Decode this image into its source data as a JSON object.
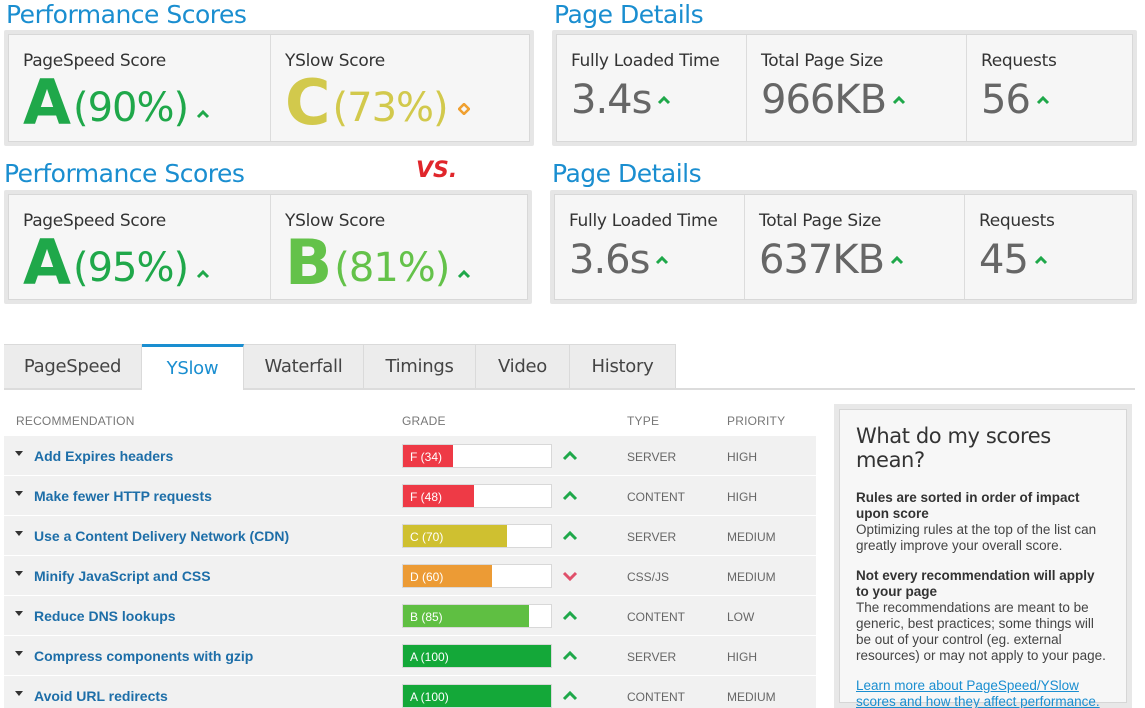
{
  "top_comparison": {
    "performance_title": "Performance Scores",
    "page_details_title": "Page Details",
    "pagespeed_label": "PageSpeed Score",
    "yslow_label": "YSlow Score",
    "fully_loaded_label": "Fully Loaded Time",
    "page_size_label": "Total Page Size",
    "requests_label": "Requests",
    "pagespeed_grade": "A",
    "pagespeed_pct": "(90%)",
    "yslow_grade": "C",
    "yslow_pct": "(73%)",
    "fully_loaded": "3.4s",
    "page_size": "966KB",
    "requests": "56"
  },
  "vs_label": "VS.",
  "bottom_comparison": {
    "performance_title": "Performance Scores",
    "page_details_title": "Page Details",
    "pagespeed_label": "PageSpeed Score",
    "yslow_label": "YSlow Score",
    "fully_loaded_label": "Fully Loaded Time",
    "page_size_label": "Total Page Size",
    "requests_label": "Requests",
    "pagespeed_grade": "A",
    "pagespeed_pct": "(95%)",
    "yslow_grade": "B",
    "yslow_pct": "(81%)",
    "fully_loaded": "3.6s",
    "page_size": "637KB",
    "requests": "45"
  },
  "tabs": [
    {
      "label": "PageSpeed",
      "active": false
    },
    {
      "label": "YSlow",
      "active": true
    },
    {
      "label": "Waterfall",
      "active": false
    },
    {
      "label": "Timings",
      "active": false
    },
    {
      "label": "Video",
      "active": false
    },
    {
      "label": "History",
      "active": false
    }
  ],
  "table": {
    "headers": {
      "recommendation": "RECOMMENDATION",
      "grade": "GRADE",
      "type": "TYPE",
      "priority": "PRIORITY"
    },
    "rows": [
      {
        "recommendation": "Add Expires headers",
        "grade": "F (34)",
        "score": 34,
        "color": "#ee3a46",
        "trend": "up",
        "type": "SERVER",
        "priority": "HIGH"
      },
      {
        "recommendation": "Make fewer HTTP requests",
        "grade": "F (48)",
        "score": 48,
        "color": "#ee3a46",
        "trend": "up",
        "type": "CONTENT",
        "priority": "HIGH"
      },
      {
        "recommendation": "Use a Content Delivery Network (CDN)",
        "grade": "C (70)",
        "score": 70,
        "color": "#cfc030",
        "trend": "up",
        "type": "SERVER",
        "priority": "MEDIUM"
      },
      {
        "recommendation": "Minify JavaScript and CSS",
        "grade": "D (60)",
        "score": 60,
        "color": "#ec9b35",
        "trend": "down",
        "type": "CSS/JS",
        "priority": "MEDIUM"
      },
      {
        "recommendation": "Reduce DNS lookups",
        "grade": "B (85)",
        "score": 85,
        "color": "#5fbf42",
        "trend": "up",
        "type": "CONTENT",
        "priority": "LOW"
      },
      {
        "recommendation": "Compress components with gzip",
        "grade": "A (100)",
        "score": 100,
        "color": "#14a839",
        "trend": "up",
        "type": "SERVER",
        "priority": "HIGH"
      },
      {
        "recommendation": "Avoid URL redirects",
        "grade": "A (100)",
        "score": 100,
        "color": "#14a839",
        "trend": "up",
        "type": "CONTENT",
        "priority": "MEDIUM"
      }
    ]
  },
  "panel": {
    "title": "What do my scores mean?",
    "h1": "Rules are sorted in order of impact upon score",
    "p1": "Optimizing rules at the top of the list can greatly improve your overall score.",
    "h2": "Not every recommendation will apply to your page",
    "p2": "The recommendations are meant to be generic, best practices; some things will be out of your control (eg. external resources) or may not apply to your page.",
    "link": "Learn more about PageSpeed/YSlow scores and how they affect performance."
  },
  "colors": {
    "accent": "#1a8ed0",
    "up_arrow": "#1fa84a",
    "down_arrow": "#e0506a",
    "neutral_diamond": "#f0a030",
    "vs": "#e0262b"
  }
}
